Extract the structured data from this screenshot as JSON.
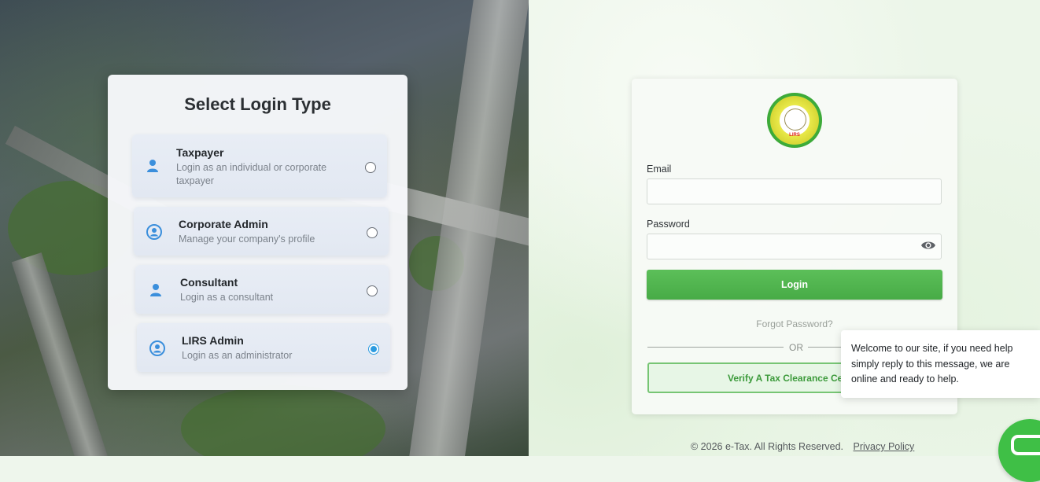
{
  "login_type": {
    "title": "Select Login Type",
    "options": [
      {
        "title": "Taxpayer",
        "description": "Login as an individual or corporate taxpayer",
        "icon": "person-icon",
        "selected": false
      },
      {
        "title": "Corporate Admin",
        "description": "Manage your company's profile",
        "icon": "account-circle-icon",
        "selected": false
      },
      {
        "title": "Consultant",
        "description": "Login as a consultant",
        "icon": "person-icon",
        "selected": false
      },
      {
        "title": "LIRS Admin",
        "description": "Login as an administrator",
        "icon": "account-circle-icon",
        "selected": true
      }
    ]
  },
  "login_form": {
    "logo_text": "LIRS",
    "email_label": "Email",
    "email_value": "",
    "password_label": "Password",
    "password_value": "",
    "login_label": "Login",
    "forgot_label": "Forgot Password?",
    "or_label": "OR",
    "verify_label": "Verify A Tax Clearance Certificate"
  },
  "chat": {
    "message": "Welcome to our site, if you need help simply reply to this message, we are online and ready to help."
  },
  "footer": {
    "copyright": "© 2026 e-Tax. All Rights Reserved.",
    "privacy_label": "Privacy Policy"
  },
  "colors": {
    "accent_green": "#47ab46",
    "radio_blue": "#2c9be0",
    "icon_blue": "#3b8fdc"
  }
}
